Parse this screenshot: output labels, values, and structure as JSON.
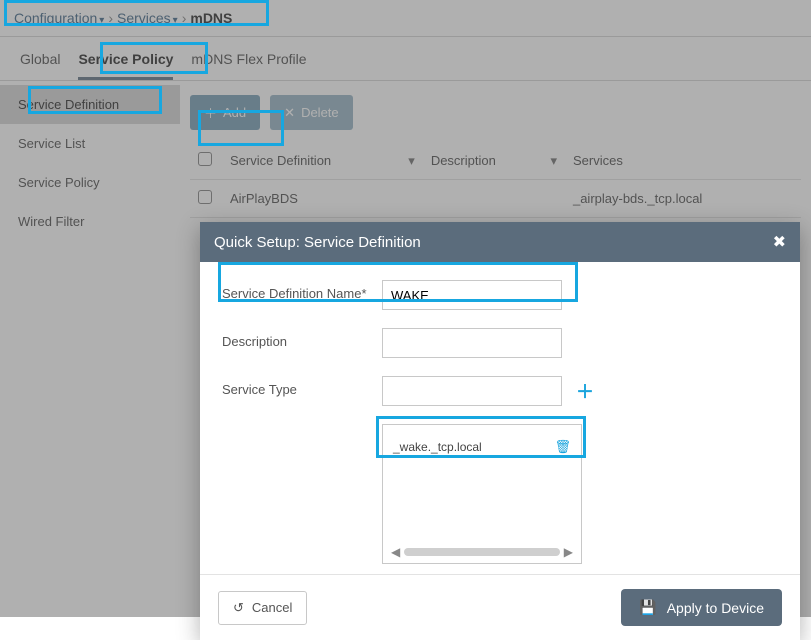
{
  "breadcrumb": {
    "configuration": "Configuration",
    "services": "Services",
    "current": "mDNS"
  },
  "tabs": {
    "global": "Global",
    "service_policy": "Service Policy",
    "flex_profile": "mDNS Flex Profile"
  },
  "sidebar": {
    "service_definition": "Service Definition",
    "service_list": "Service List",
    "service_policy": "Service Policy",
    "wired_filter": "Wired Filter"
  },
  "toolbar": {
    "add_label": "Add",
    "delete_label": "Delete"
  },
  "table": {
    "col_definition": "Service Definition",
    "col_description": "Description",
    "col_services": "Services",
    "rows": [
      {
        "definition": "AirPlayBDS",
        "description": "",
        "services": "_airplay-bds._tcp.local"
      }
    ]
  },
  "dialog": {
    "title": "Quick Setup: Service Definition",
    "fields": {
      "name_label": "Service Definition Name*",
      "name_value": "WAKE",
      "desc_label": "Description",
      "desc_value": "",
      "type_label": "Service Type",
      "type_input": "",
      "type_entries": [
        "_wake._tcp.local"
      ]
    },
    "footer": {
      "cancel": "Cancel",
      "apply": "Apply to Device"
    }
  }
}
